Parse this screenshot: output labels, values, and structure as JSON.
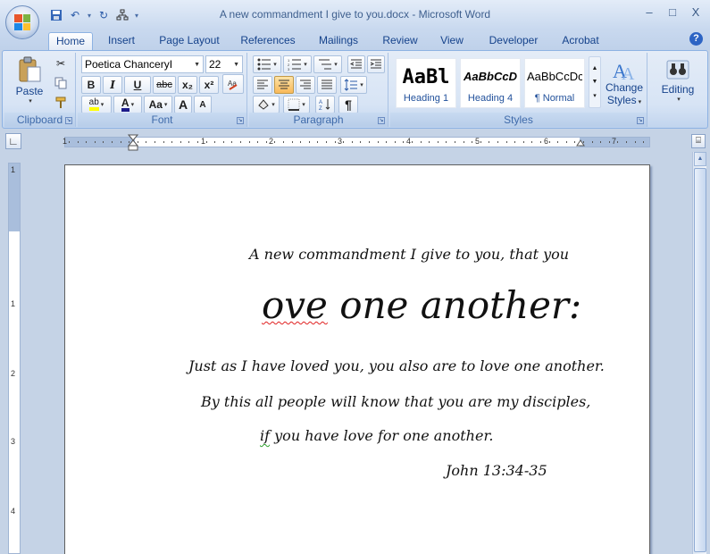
{
  "window": {
    "title": "A new commandment I give to you.docx - Microsoft Word",
    "controls": {
      "minimize": "–",
      "maximize": "□",
      "close": "X"
    }
  },
  "quick_access": {
    "separator": "▾"
  },
  "tabs": [
    {
      "label": "Home",
      "active": true
    },
    {
      "label": "Insert"
    },
    {
      "label": "Page Layout"
    },
    {
      "label": "References"
    },
    {
      "label": "Mailings"
    },
    {
      "label": "Review"
    },
    {
      "label": "View"
    },
    {
      "label": "Developer"
    },
    {
      "label": "Acrobat"
    }
  ],
  "help": "?",
  "ribbon": {
    "clipboard": {
      "label": "Clipboard",
      "paste": "Paste"
    },
    "font": {
      "label": "Font",
      "font_name": "Poetica ChanceryI",
      "font_size": "22",
      "bold": "B",
      "italic": "I",
      "underline": "U",
      "strike": "abc",
      "subscript": "x₂",
      "superscript": "x²",
      "highlight": "ab",
      "font_color": "A",
      "change_case": "Aa",
      "grow": "A",
      "shrink": "A"
    },
    "paragraph": {
      "label": "Paragraph"
    },
    "styles": {
      "label": "Styles",
      "items": [
        {
          "preview": "AaBl",
          "name": "Heading 1"
        },
        {
          "preview": "AaBbCcD",
          "name": "Heading 4"
        },
        {
          "preview": "AaBbCcDc",
          "name": "¶ Normal"
        }
      ],
      "change_styles": "Change",
      "change_styles_2": "Styles"
    },
    "editing": {
      "label": "Editing"
    }
  },
  "ruler": {
    "h_numbers": [
      "1",
      "1",
      "2",
      "3",
      "4",
      "5",
      "6",
      "7"
    ],
    "v_numbers": [
      "1",
      "1",
      "2",
      "3",
      "4"
    ]
  },
  "document": {
    "lines": [
      "A new commandment I give to you, that you",
      "ove one another:",
      "Just as I have loved you, you also are to love one another.",
      "By this all people will know that you are my disciples,",
      "you have love for one another.",
      "John 13:34-35"
    ],
    "misspelled_word": "if"
  },
  "colors": {
    "accent": "#15428b",
    "ribbon_bg": "#d7e4f5",
    "workspace": "#c5d3e6",
    "pressed": "#f9b95a"
  }
}
